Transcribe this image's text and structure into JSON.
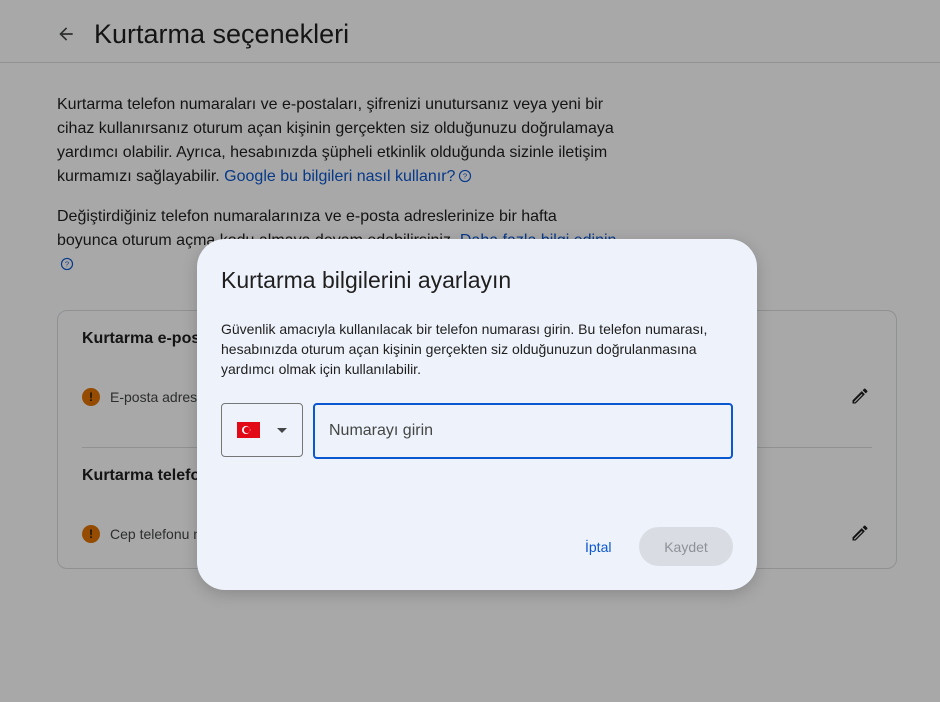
{
  "header": {
    "back_icon": "arrow-back-icon",
    "title": "Kurtarma seçenekleri"
  },
  "intro": {
    "text": "Kurtarma telefon numaraları ve e-postaları, şifrenizi unutursanız veya yeni bir cihaz kullanırsanız oturum açan kişinin gerçekten siz olduğunuzu doğrulamaya yardımcı olabilir. Ayrıca, hesabınızda şüpheli etkinlik olduğunda sizinle iletişim kurmamızı sağlayabilir.",
    "link": "Google bu bilgileri nasıl kullanır?"
  },
  "notice": {
    "text": "Değiştirdiğiniz telefon numaralarınıza ve e-posta adreslerinize bir hafta boyunca oturum açma kodu almaya devam edebilirsiniz.",
    "link": "Daha fazla bilgi edinin"
  },
  "card": {
    "email_section": {
      "title": "Kurtarma e-posta adresi",
      "status": "E-posta adresi ekleyin"
    },
    "phone_section": {
      "title": "Kurtarma telefonu",
      "status": "Cep telefonu numarası ekleyin"
    }
  },
  "dialog": {
    "title": "Kurtarma bilgilerini ayarlayın",
    "description": "Güvenlik amacıyla kullanılacak bir telefon numarası girin. Bu telefon numarası, hesabınızda oturum açan kişinin gerçekten siz olduğunuzun doğrulanmasına yardımcı olmak için kullanılabilir.",
    "country_flag": "turkey-flag",
    "phone_placeholder": "Numarayı girin",
    "phone_value": "",
    "cancel_label": "İptal",
    "save_label": "Kaydet"
  },
  "colors": {
    "accent": "#0b57d0",
    "warning": "#e37400",
    "dialog_bg": "#eef2fa"
  }
}
